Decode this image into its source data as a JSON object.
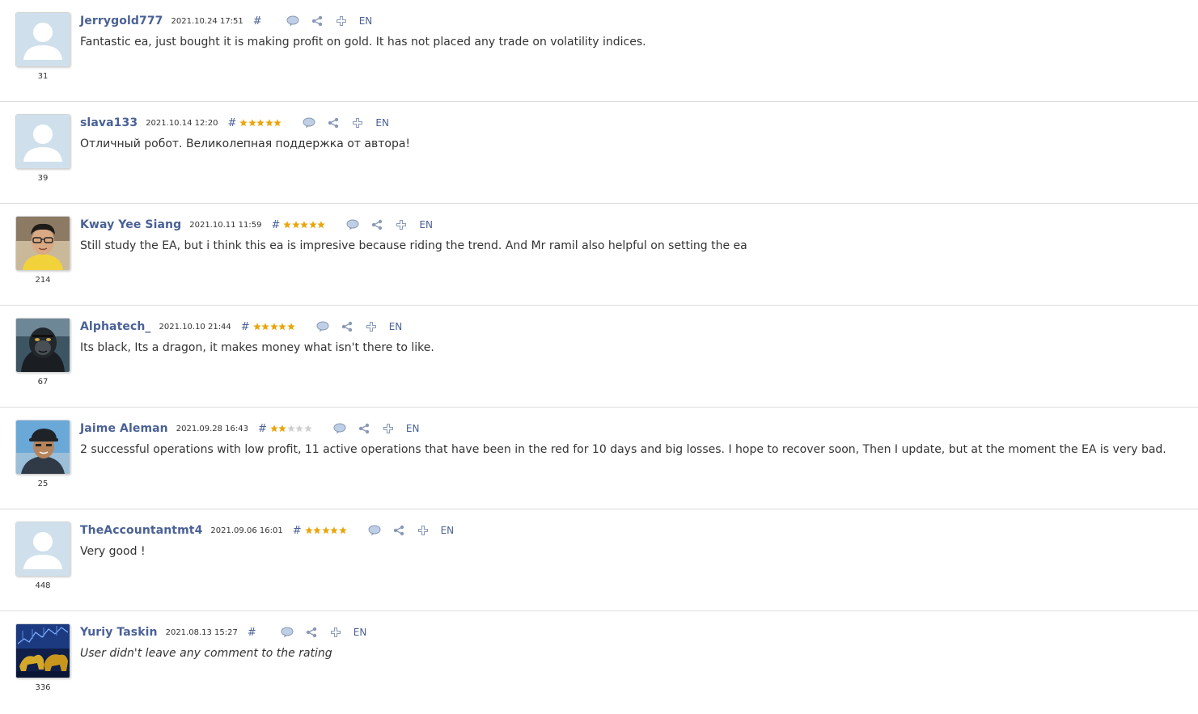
{
  "colors": {
    "author": "#4a6196",
    "star_filled": "#e8a60c",
    "star_empty": "#d0d0d0",
    "icon": "#8a9ab5",
    "divider": "#dddddd"
  },
  "icons": {
    "reply": "comment-bubble-icon",
    "share": "share-icon",
    "add": "plus-icon"
  },
  "reviews": [
    {
      "author": "Jerrygold777",
      "date": "2021.10.24 17:51",
      "permalink": "#",
      "stars": 0,
      "lang": "EN",
      "comment": "Fantastic ea, just bought it is making profit on gold. It has not placed any trade on volatility indices.",
      "rating_count": "31",
      "avatar": "default",
      "italic": false
    },
    {
      "author": "slava133",
      "date": "2021.10.14 12:20",
      "permalink": "#",
      "stars": 5,
      "lang": "EN",
      "comment": "Отличный робот. Великолепная поддержка от автора!",
      "rating_count": "39",
      "avatar": "default",
      "italic": false
    },
    {
      "author": "Kway Yee Siang",
      "date": "2021.10.11 11:59",
      "permalink": "#",
      "stars": 5,
      "lang": "EN",
      "comment": "Still study the EA, but i think this ea is impresive because riding the trend. And Mr ramil also helpful on setting the ea",
      "rating_count": "214",
      "avatar": "man-glasses",
      "italic": false
    },
    {
      "author": "Alphatech_",
      "date": "2021.10.10 21:44",
      "permalink": "#",
      "stars": 5,
      "lang": "EN",
      "comment": "Its black, Its a dragon, it makes money what isn't there to like.",
      "rating_count": "67",
      "avatar": "ape",
      "italic": false
    },
    {
      "author": "Jaime Aleman",
      "date": "2021.09.28 16:43",
      "permalink": "#",
      "stars": 2,
      "lang": "EN",
      "comment": "2 successful operations with low profit, 11 active operations that have been in the red for 10 days and big losses. I hope to recover soon, Then I update, but at the moment the EA is very bad.",
      "rating_count": "25",
      "avatar": "man-cap",
      "italic": false
    },
    {
      "author": "TheAccountantmt4",
      "date": "2021.09.06 16:01",
      "permalink": "#",
      "stars": 5,
      "lang": "EN",
      "comment": "Very good !",
      "rating_count": "448",
      "avatar": "default",
      "italic": false
    },
    {
      "author": "Yuriy Taskin",
      "date": "2021.08.13 15:27",
      "permalink": "#",
      "stars": 0,
      "lang": "EN",
      "comment": "User didn't leave any comment to the rating",
      "rating_count": "336",
      "avatar": "bull-chart",
      "italic": true
    }
  ]
}
